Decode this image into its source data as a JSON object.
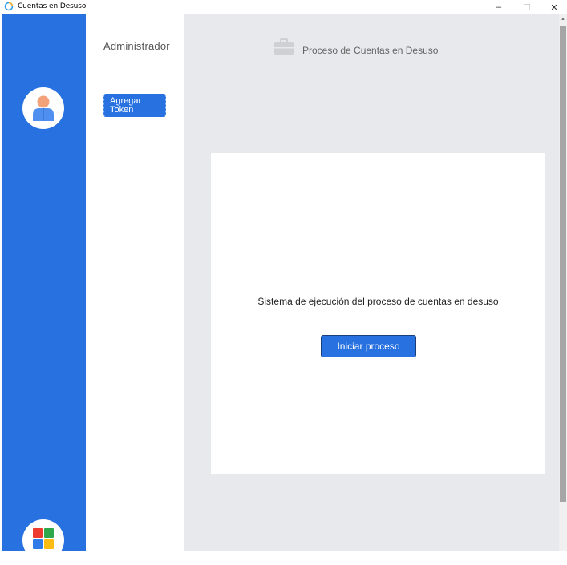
{
  "window": {
    "title": "Cuentas en Desuso",
    "minimize": "–",
    "maximize": "☐",
    "close": "✕"
  },
  "sidebar": {
    "avatar_icon": "user-avatar-icon",
    "apps_icon": "apps-grid-icon"
  },
  "nav": {
    "heading": "Administrador",
    "button_line1": "Agregar",
    "button_line2": "Token"
  },
  "main": {
    "header_icon": "briefcase-icon",
    "header_title": "Proceso de Cuentas en Desuso",
    "card_text": "Sistema de ejecución del proceso de cuentas en desuso",
    "start_button": "Iniciar proceso"
  },
  "colors": {
    "brand_blue": "#2771e0",
    "main_bg": "#e8e9ec",
    "avatar_skin": "#f4a27a",
    "avatar_body": "#4f8ff0",
    "apps_red": "#ee3b2f",
    "apps_green": "#2ea84a",
    "apps_blue": "#2f7ce8",
    "apps_yellow": "#fcbc12"
  }
}
